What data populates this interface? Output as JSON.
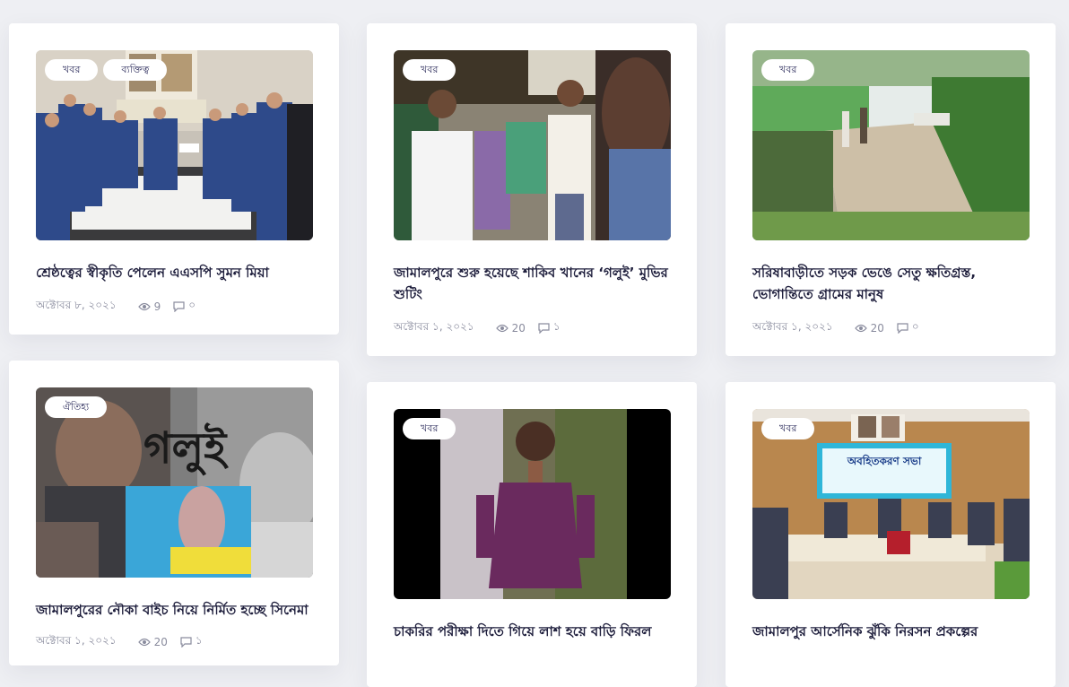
{
  "posts": [
    {
      "tags": [
        "খবর",
        "ব্যক্তিত্ব"
      ],
      "title": "শ্রেষ্ঠত্বের স্বীকৃতি পেলেন এএসপি সুমন মিয়া",
      "date": "অক্টোবর ৮, ২০২১",
      "views": "9",
      "comments": "০",
      "image": "police-award-photo"
    },
    {
      "tags": [
        "খবর"
      ],
      "title": "জামালপুরে শুরু হয়েছে শাকিব খানের ‘গলুই’ মুভির শুটিং",
      "date": "অক্টোবর ১, ২০২১",
      "views": "20",
      "comments": "১",
      "image": "film-shooting-crowd-photo"
    },
    {
      "tags": [
        "খবর"
      ],
      "title": "সরিষাবাড়ীতে সড়ক ভেঙে সেতু ক্ষতিগ্রস্ত, ভোগান্তিতে গ্রামের মানুষ",
      "date": "অক্টোবর ১, ২০২১",
      "views": "20",
      "comments": "০",
      "image": "damaged-bridge-photo"
    },
    {
      "tags": [
        "ঐতিহ্য"
      ],
      "title": "জামালপুরের নৌকা বাইচ নিয়ে নির্মিত হচ্ছে সিনেমা",
      "date": "অক্টোবর ১, ২০২১",
      "views": "20",
      "comments": "১",
      "image": "film-poster-golui",
      "poster_text": "গলুই"
    },
    {
      "tags": [
        "খবর"
      ],
      "title": "চাকরির পরীক্ষা দিতে গিয়ে লাশ হয়ে বাড়ি ফিরল",
      "date": "",
      "views": "",
      "comments": "",
      "image": "young-man-portrait-photo"
    },
    {
      "tags": [
        "খবর"
      ],
      "title": "জামালপুর আর্সেনিক ঝুঁকি নিরসন প্রকল্পের",
      "date": "",
      "views": "",
      "comments": "",
      "image": "meeting-hall-photo",
      "banner_text": "অবহিতকরণ সভা"
    }
  ],
  "colors": {
    "background": "#eeeff3",
    "card": "#ffffff",
    "title": "#1e1e3c",
    "meta": "#8a8c9e",
    "tag_text": "#2b2b5b"
  },
  "icons": {
    "views": "eye-icon",
    "comments": "comment-icon"
  }
}
